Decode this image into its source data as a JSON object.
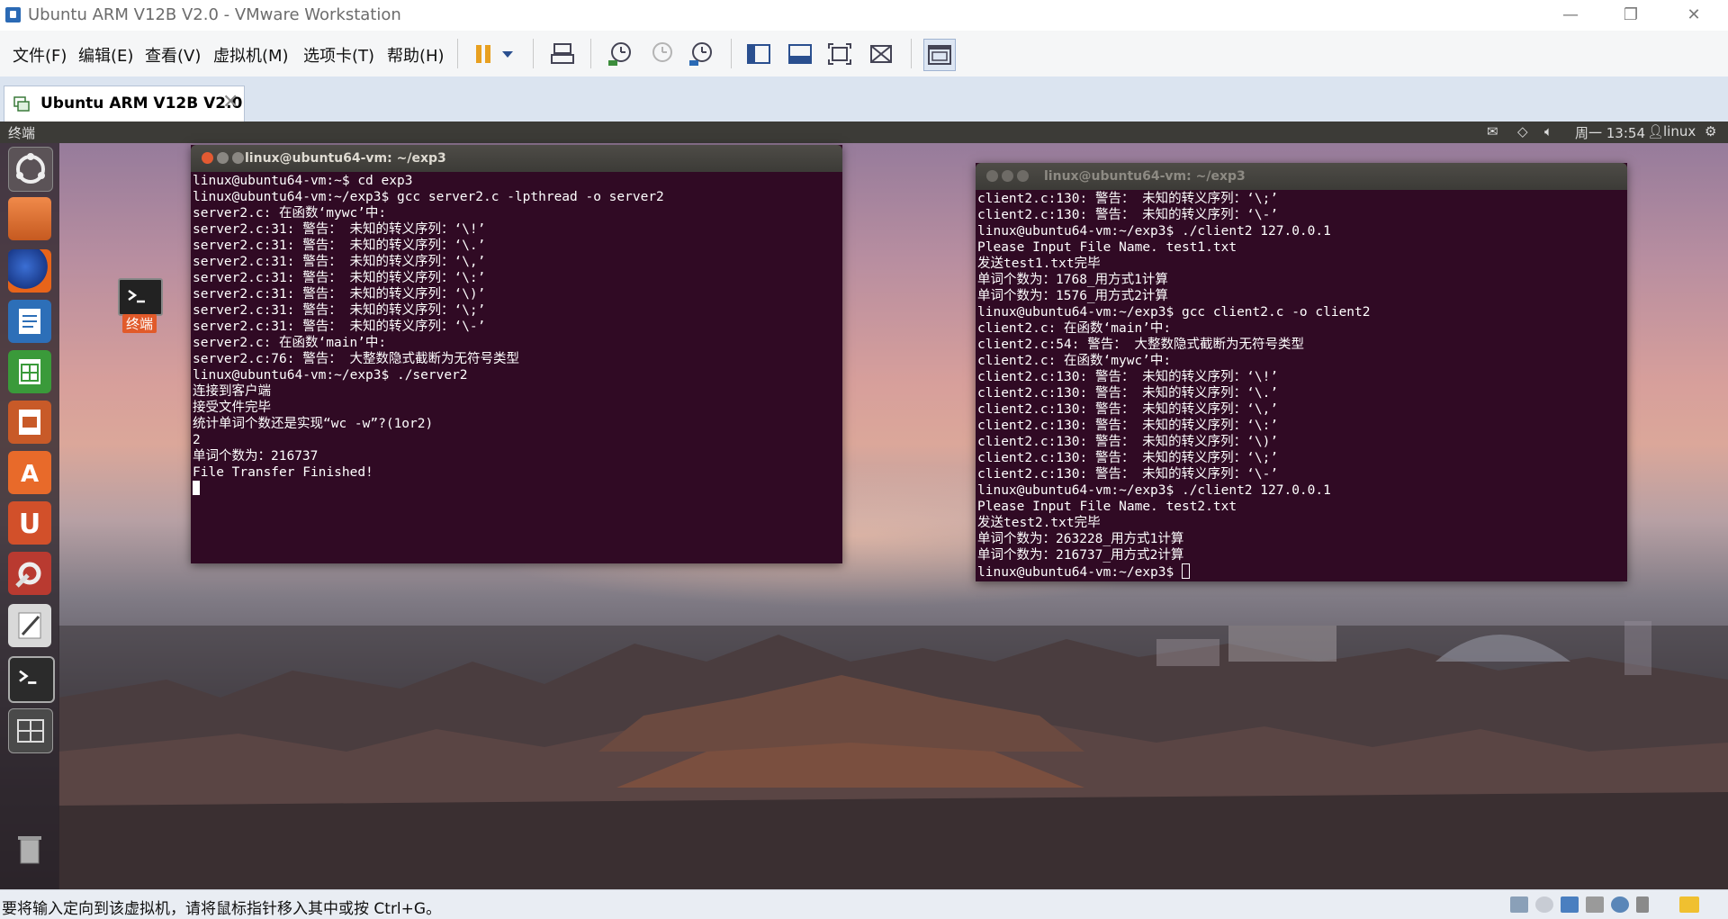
{
  "window": {
    "title": "Ubuntu ARM V12B V2.0 - VMware Workstation",
    "controls": {
      "minimize": "—",
      "restore": "❐",
      "close": "✕"
    }
  },
  "menu": [
    "文件(F)",
    "编辑(E)",
    "查看(V)",
    "虚拟机(M)",
    "选项卡(T)",
    "帮助(H)"
  ],
  "toolbar": {
    "buttons": [
      "pause-icon",
      "dropdown-arrow-icon",
      "send-keys-icon",
      "snapshot-take-icon",
      "snapshot-revert-icon",
      "snapshot-manager-icon",
      "console-view-icon",
      "unity-view-icon",
      "fullscreen-icon",
      "autofit-icon",
      "library-view-icon"
    ],
    "accent": "#e8a020"
  },
  "tab": {
    "label": "Ubuntu ARM V12B V2.0",
    "close": "✕"
  },
  "guest": {
    "topbar": {
      "title": "终端",
      "clock": "周一 13:54",
      "user": "linux"
    },
    "launcher": [
      "dash-home-icon",
      "files-icon",
      "firefox-icon",
      "writer-icon",
      "calc-icon",
      "impress-icon",
      "software-center-icon",
      "ubuntu-one-icon",
      "system-settings-icon",
      "text-editor-icon",
      "terminal-icon",
      "workspace-switcher-icon",
      "trash-icon"
    ],
    "desktop_icon_label": "终端"
  },
  "term_left": {
    "title": "linux@ubuntu64-vm: ~/exp3",
    "lines": [
      "linux@ubuntu64-vm:~$ cd exp3",
      "linux@ubuntu64-vm:~/exp3$ gcc server2.c -lpthread -o server2",
      "server2.c: 在函数‘mywc’中:",
      "server2.c:31: 警告： 未知的转义序列：‘\\!’",
      "server2.c:31: 警告： 未知的转义序列：‘\\.’",
      "server2.c:31: 警告： 未知的转义序列：‘\\,’",
      "server2.c:31: 警告： 未知的转义序列：‘\\:’",
      "server2.c:31: 警告： 未知的转义序列：‘\\)’",
      "server2.c:31: 警告： 未知的转义序列：‘\\;’",
      "server2.c:31: 警告： 未知的转义序列：‘\\-’",
      "server2.c: 在函数‘main’中:",
      "server2.c:76: 警告： 大整数隐式截断为无符号类型",
      "linux@ubuntu64-vm:~/exp3$ ./server2",
      "连接到客户端",
      "接受文件完毕",
      "统计单词个数还是实现“wc -w”?(1or2)",
      "2",
      "单词个数为：216737",
      "File Transfer Finished!"
    ]
  },
  "term_right": {
    "title": "linux@ubuntu64-vm: ~/exp3",
    "lines": [
      "client2.c:130: 警告： 未知的转义序列：‘\\;’",
      "client2.c:130: 警告： 未知的转义序列：‘\\-’",
      "linux@ubuntu64-vm:~/exp3$ ./client2 127.0.0.1",
      "Please Input File Name. test1.txt",
      "发送test1.txt完毕",
      "单词个数为：1768_用方式1计算",
      "单词个数为：1576_用方式2计算",
      "linux@ubuntu64-vm:~/exp3$ gcc client2.c -o client2",
      "client2.c: 在函数‘main’中:",
      "client2.c:54: 警告： 大整数隐式截断为无符号类型",
      "client2.c: 在函数‘mywc’中:",
      "client2.c:130: 警告： 未知的转义序列：‘\\!’",
      "client2.c:130: 警告： 未知的转义序列：‘\\.’",
      "client2.c:130: 警告： 未知的转义序列：‘\\,’",
      "client2.c:130: 警告： 未知的转义序列：‘\\:’",
      "client2.c:130: 警告： 未知的转义序列：‘\\)’",
      "client2.c:130: 警告： 未知的转义序列：‘\\;’",
      "client2.c:130: 警告： 未知的转义序列：‘\\-’",
      "linux@ubuntu64-vm:~/exp3$ ./client2 127.0.0.1",
      "Please Input File Name. test2.txt",
      "发送test2.txt完毕",
      "单词个数为：263228_用方式1计算",
      "单词个数为：216737_用方式2计算",
      "linux@ubuntu64-vm:~/exp3$ "
    ]
  },
  "statusbar": {
    "message": "要将输入定向到该虚拟机，请将鼠标指针移入其中或按 Ctrl+G。",
    "icons": [
      "hdd-icon",
      "cd-icon",
      "network-icon",
      "printer-icon",
      "sound-icon",
      "usb-icon",
      "message-icon"
    ]
  },
  "colors": {
    "terminal_bg": "#300a24",
    "terminal_fg": "#ffffff",
    "ubuntu_titlebar": "#3c3b37",
    "close_btn": "#e35a32",
    "vmware_tabbar": "#dbe4f0"
  }
}
